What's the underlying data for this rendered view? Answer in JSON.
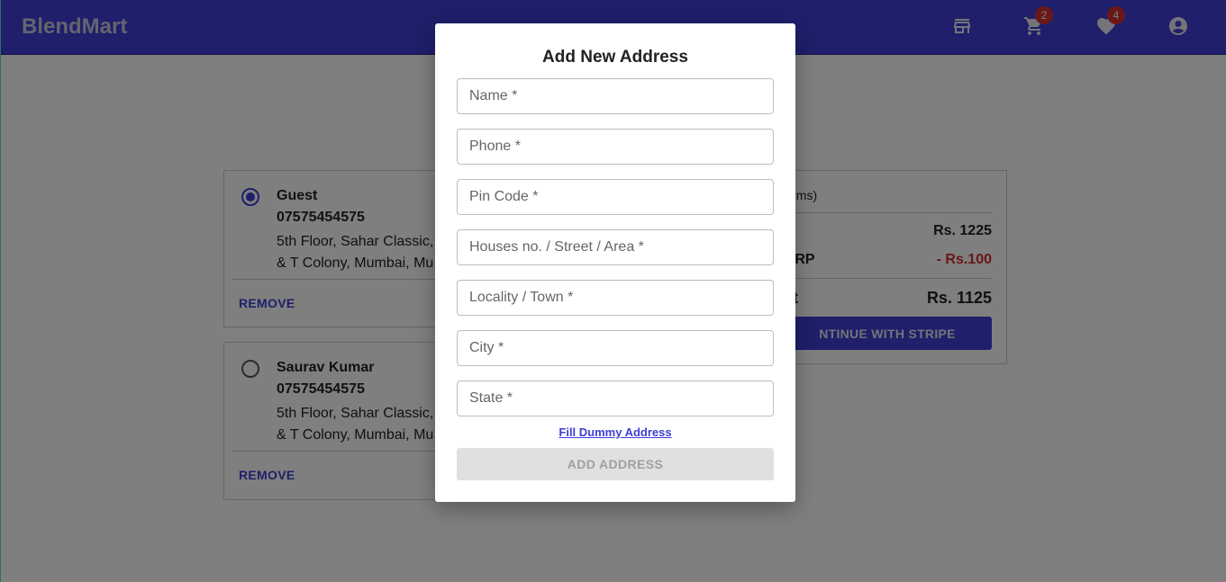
{
  "header": {
    "brand": "BlendMart",
    "cart_count": "2",
    "wishlist_count": "4",
    "icons": [
      "store-icon",
      "cart-icon",
      "heart-icon",
      "account-icon"
    ]
  },
  "addresses": [
    {
      "name": "Guest",
      "phone": "07575454575",
      "line1": "5th Floor, Sahar Classic,",
      "line2": "& T Colony, Mumbai, Mu",
      "selected": true,
      "remove_label": "REMOVE"
    },
    {
      "name": "Saurav Kumar",
      "phone": "07575454575",
      "line1": "5th Floor, Sahar Classic,",
      "line2": "& T Colony, Mumbai, Mu",
      "selected": false,
      "remove_label": "REMOVE"
    }
  ],
  "summary": {
    "title_fragment": "items)",
    "price": "Rs. 1225",
    "discount_label": "MRP",
    "discount_value": "- Rs.100",
    "total_label": "nt",
    "total_value": "Rs. 1125",
    "checkout_label": "NTINUE WITH STRIPE"
  },
  "modal": {
    "title": "Add New Address",
    "fields": {
      "name": "Name *",
      "phone": "Phone *",
      "pincode": "Pin Code *",
      "house": "Houses no. / Street / Area *",
      "locality": "Locality / Town *",
      "city": "City *",
      "state": "State *"
    },
    "dummy_link": "Fill Dummy Address",
    "submit_label": "ADD ADDRESS"
  },
  "colors": {
    "primary": "#3f3fd6",
    "badge": "#d32f2f",
    "discount": "#d32f2f"
  }
}
